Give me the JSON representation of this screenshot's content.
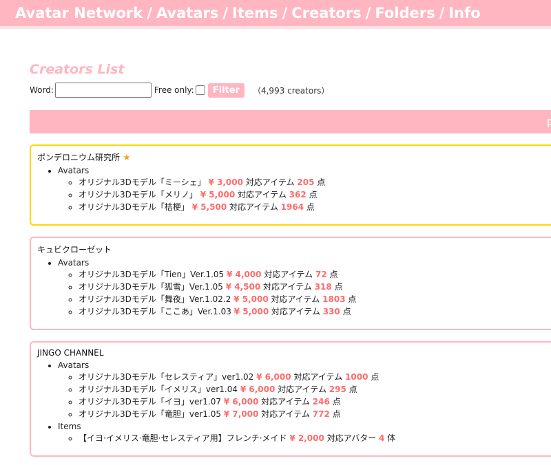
{
  "nav": {
    "links": [
      "Avatar Network",
      "Avatars",
      "Items",
      "Creators",
      "Folders",
      "Info"
    ],
    "separator": "/"
  },
  "page": {
    "title": "Creators List",
    "word_label": "Word:",
    "word_value": "",
    "free_only_label": "Free only:",
    "filter_button": "Filter",
    "count_text": "（4,993 creators）",
    "pager_glyph": "p"
  },
  "creators": [
    {
      "name": "ポンデロニウム研究所",
      "favorite": true,
      "sections": [
        {
          "label": "Avatars",
          "items": [
            {
              "name": "オリジナル3Dモデル「ミーシェ」",
              "price": "¥ 3,000",
              "count_label": "対応アイテム",
              "count": "205",
              "unit": "点"
            },
            {
              "name": "オリジナル3Dモデル「メリノ」",
              "price": "¥ 5,000",
              "count_label": "対応アイテム",
              "count": "362",
              "unit": "点"
            },
            {
              "name": "オリジナル3Dモデル「桔梗」",
              "price": "¥ 5,500",
              "count_label": "対応アイテム",
              "count": "1964",
              "unit": "点"
            }
          ]
        }
      ]
    },
    {
      "name": "キュビクローゼット",
      "favorite": false,
      "sections": [
        {
          "label": "Avatars",
          "items": [
            {
              "name": "オリジナル3Dモデル「Tien」Ver.1.05",
              "price": "¥ 4,000",
              "count_label": "対応アイテム",
              "count": "72",
              "unit": "点"
            },
            {
              "name": "オリジナル3Dモデル「狐雪」Ver.1.05",
              "price": "¥ 4,500",
              "count_label": "対応アイテム",
              "count": "318",
              "unit": "点"
            },
            {
              "name": "オリジナル3Dモデル「舞夜」Ver.1.02.2",
              "price": "¥ 5,000",
              "count_label": "対応アイテム",
              "count": "1803",
              "unit": "点"
            },
            {
              "name": "オリジナル3Dモデル「ここあ」Ver.1.03",
              "price": "¥ 5,000",
              "count_label": "対応アイテム",
              "count": "330",
              "unit": "点"
            }
          ]
        }
      ]
    },
    {
      "name": "JINGO CHANNEL",
      "favorite": false,
      "sections": [
        {
          "label": "Avatars",
          "items": [
            {
              "name": "オリジナル3Dモデル「セレスティア」ver1.02",
              "price": "¥ 6,000",
              "count_label": "対応アイテム",
              "count": "1000",
              "unit": "点"
            },
            {
              "name": "オリジナル3Dモデル「イメリス」ver1.04",
              "price": "¥ 6,000",
              "count_label": "対応アイテム",
              "count": "295",
              "unit": "点"
            },
            {
              "name": "オリジナル3Dモデル「イヨ」ver1.07",
              "price": "¥ 6,000",
              "count_label": "対応アイテム",
              "count": "246",
              "unit": "点"
            },
            {
              "name": "オリジナル3Dモデル「竜胆」ver1.05",
              "price": "¥ 7,000",
              "count_label": "対応アイテム",
              "count": "772",
              "unit": "点"
            }
          ]
        },
        {
          "label": "Items",
          "items": [
            {
              "name": "【イヨ·イメリス·竜胆·セレスティア用】フレンチ·メイド",
              "price": "¥ 2,000",
              "count_label": "対応アバター",
              "count": "4",
              "unit": "体"
            }
          ]
        }
      ]
    }
  ],
  "colors": {
    "accent": "#ffb6c1",
    "price": "#ff6b6b",
    "favorite_border": "#ffd700",
    "star": "#f5a623"
  },
  "icons": {
    "favorite": "star-icon"
  }
}
